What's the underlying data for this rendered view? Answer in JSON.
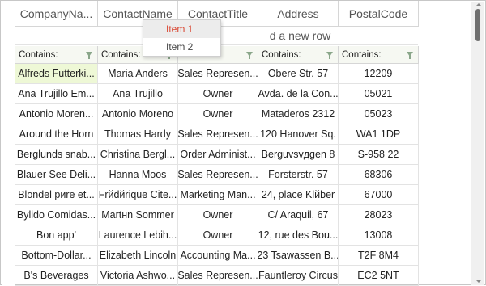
{
  "header": {
    "columns": [
      "CompanyNa...",
      "ContactName",
      "ContactTitle",
      "Address",
      "PostalCode"
    ]
  },
  "new_row_text": "Click here to add a new row",
  "new_row_visible": "d a new row",
  "filter": {
    "label": "Contains:"
  },
  "context_menu": {
    "items": [
      "Item 1",
      "Item 2"
    ],
    "active_color": "#d9442f"
  },
  "rows": [
    [
      "Alfreds Futterki...",
      "Maria Anders",
      "Sales Represen...",
      "Obere Str. 57",
      "12209"
    ],
    [
      "Ana Trujillo Em...",
      "Ana Trujillo",
      "Owner",
      "Avda. de la Con...",
      "05021"
    ],
    [
      "Antonio Moren...",
      "Antonio Moreno",
      "Owner",
      "Mataderos 2312",
      "05023"
    ],
    [
      "Around the Horn",
      "Thomas Hardy",
      "Sales Represen...",
      "120 Hanover Sq.",
      "WA1 1DP"
    ],
    [
      "Berglunds snab...",
      "Christina Bergl...",
      "Order Administ...",
      "Berguvsvдgen 8",
      "S-958 22"
    ],
    [
      "Blauer See Deli...",
      "Hanna Moos",
      "Sales Represen...",
      "Forsterstr. 57",
      "68306"
    ],
    [
      "Blondel pиre et...",
      "Frйdйrique Cite...",
      "Marketing Man...",
      "24, place Klйber",
      "67000"
    ],
    [
      "Bylido Comidas...",
      "Martнn Sommer",
      "Owner",
      "C/ Araquil, 67",
      "28023"
    ],
    [
      "Bon app'",
      "Laurence Lebih...",
      "Owner",
      "12, rue des Bou...",
      "13008"
    ],
    [
      "Bottom-Dollar...",
      "Elizabeth Lincoln",
      "Accounting Ma...",
      "23 Tsawassen B...",
      "T2F 8M4"
    ],
    [
      "B's Beverages",
      "Victoria Ashwo...",
      "Sales Represen...",
      "Fauntleroy Circus",
      "EC2 5NT"
    ]
  ],
  "colors": {
    "selected_cell": "#eef8d6",
    "filter_bg": "#f6f8f2",
    "grid_line": "#e3e3e3"
  }
}
